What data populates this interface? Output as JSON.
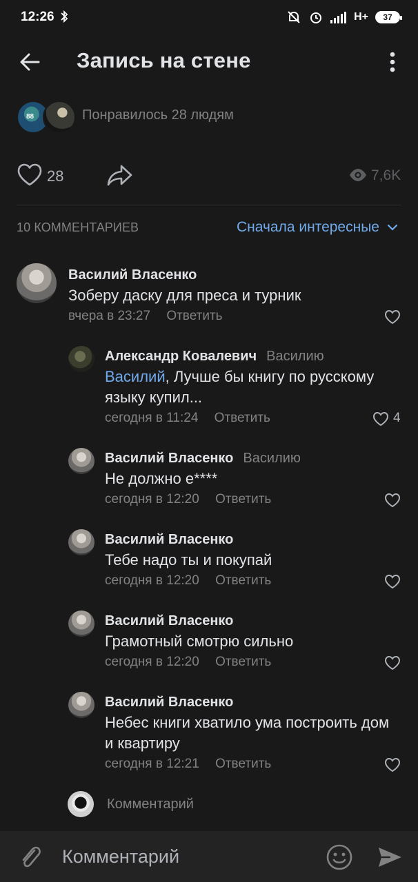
{
  "status_bar": {
    "time": "12:26",
    "network": "H+",
    "battery": "37"
  },
  "header": {
    "title": "Запись на стене"
  },
  "likes": {
    "liked_by_text": "Понравилось 28 людям",
    "avatar1_number": "88"
  },
  "actions": {
    "likes_count": "28",
    "views_count": "7,6K"
  },
  "comments_header": {
    "count_label": "10 КОММЕНТАРИЕВ",
    "sort_label": "Сначала интересные"
  },
  "comments": [
    {
      "author": "Василий Власенко",
      "reply_to": "",
      "mention": "",
      "text": "Зоберу даску для преса и турник",
      "time": "вчера в 23:27",
      "reply_label": "Ответить",
      "likes": ""
    },
    {
      "author": "Александр Ковалевич",
      "reply_to": "Василию",
      "mention": "Василий",
      "text": ", Лучше бы книгу по русскому языку купил...",
      "time": "сегодня в 11:24",
      "reply_label": "Ответить",
      "likes": "4"
    },
    {
      "author": "Василий Власенко",
      "reply_to": "Василию",
      "mention": "",
      "text": "Не должно е****",
      "time": "сегодня в 12:20",
      "reply_label": "Ответить",
      "likes": ""
    },
    {
      "author": "Василий Власенко",
      "reply_to": "",
      "mention": "",
      "text": "Тебе надо ты и покупай",
      "time": "сегодня в 12:20",
      "reply_label": "Ответить",
      "likes": ""
    },
    {
      "author": "Василий Власенко",
      "reply_to": "",
      "mention": "",
      "text": "Грамотный смотрю сильно",
      "time": "сегодня в 12:20",
      "reply_label": "Ответить",
      "likes": ""
    },
    {
      "author": "Василий Власенко",
      "reply_to": "",
      "mention": "",
      "text": "Небес книги хватило ума построить дом и квартиру",
      "time": "сегодня в 12:21",
      "reply_label": "Ответить",
      "likes": ""
    }
  ],
  "composer": {
    "inline_placeholder": "Комментарий",
    "input_placeholder": "Комментарий"
  },
  "colors": {
    "background": "#19191a",
    "accent": "#71aaeb",
    "secondary_text": "#828282",
    "primary_text": "#e1e3e6"
  },
  "icons": [
    "back-arrow-icon",
    "more-vertical-icon",
    "heart-icon",
    "share-icon",
    "eye-icon",
    "chevron-down-icon",
    "paperclip-icon",
    "emoji-icon",
    "send-icon",
    "bluetooth-icon",
    "mute-bell-icon",
    "alarm-icon",
    "signal-icon",
    "battery-icon"
  ]
}
